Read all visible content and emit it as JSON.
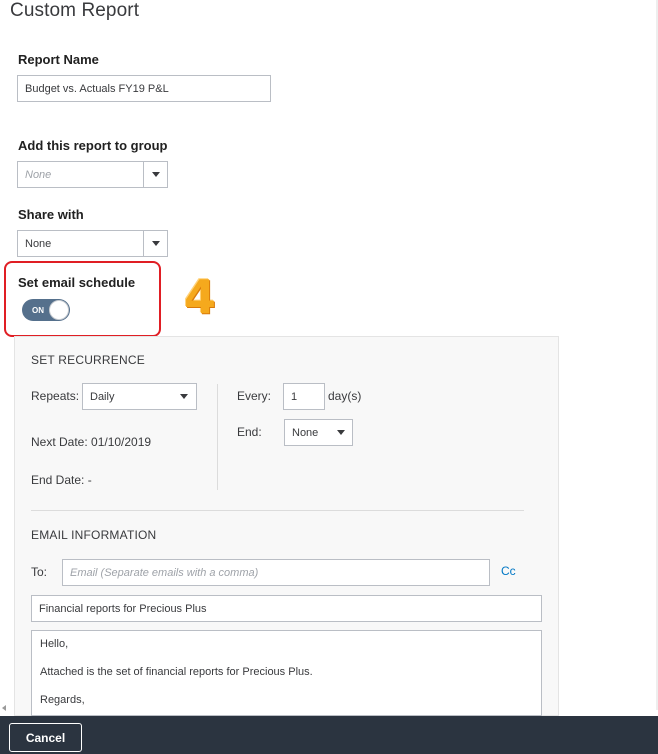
{
  "page": {
    "title": "Custom Report"
  },
  "report_name": {
    "label": "Report Name",
    "value": "Budget vs. Actuals FY19 P&L"
  },
  "group": {
    "label": "Add this report to group",
    "value": "None"
  },
  "share": {
    "label": "Share with",
    "value": "None"
  },
  "email_schedule": {
    "label": "Set email schedule",
    "toggle_label": "ON",
    "enabled": true,
    "step_number": "4"
  },
  "recurrence": {
    "title": "SET RECURRENCE",
    "repeats_label": "Repeats:",
    "repeats_value": "Daily",
    "next_date": "Next Date: 01/10/2019",
    "end_date": "End Date: -",
    "every_label": "Every:",
    "every_value": "1",
    "every_unit": "day(s)",
    "end_label": "End:",
    "end_value": "None"
  },
  "email": {
    "title": "EMAIL INFORMATION",
    "to_label": "To:",
    "to_placeholder": "Email (Separate emails with a comma)",
    "cc_label": "Cc",
    "subject": "Financial reports for Precious Plus",
    "body_lines": [
      "Hello,",
      "Attached is the set of financial reports for Precious Plus.",
      "Regards,"
    ]
  },
  "footer": {
    "cancel_label": "Cancel"
  },
  "colors": {
    "highlight": "#e01e24",
    "toggle": "#55708c",
    "footer": "#2b3440",
    "link": "#0077c5",
    "step_number": "#f5a91d"
  }
}
